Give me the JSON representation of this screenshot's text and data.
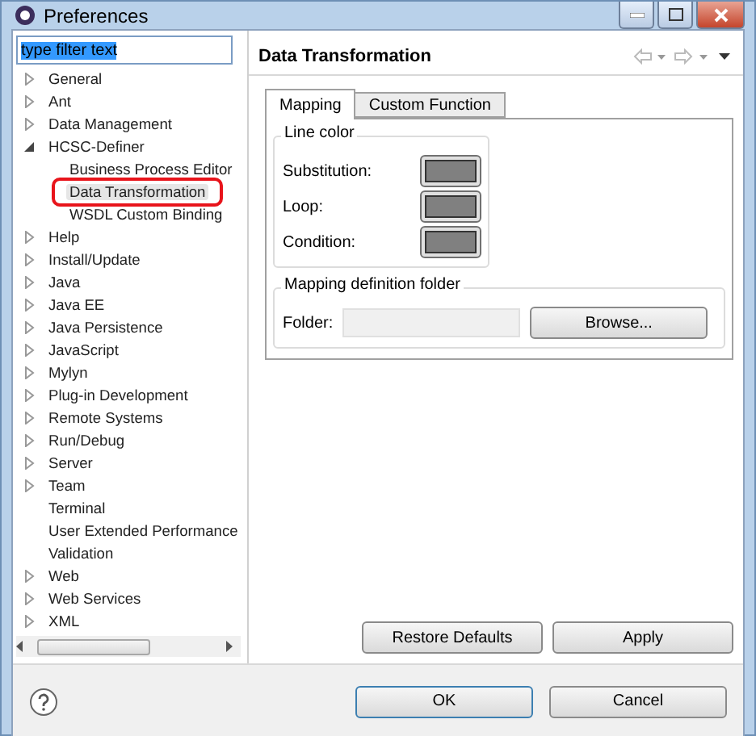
{
  "window": {
    "title": "Preferences"
  },
  "filter": {
    "value": "type filter text"
  },
  "tree": [
    {
      "label": "General",
      "expanded": false,
      "selected": false,
      "highlighted": false
    },
    {
      "label": "Ant",
      "expanded": false,
      "selected": false,
      "highlighted": false
    },
    {
      "label": "Data Management",
      "expanded": false,
      "selected": false,
      "highlighted": false
    },
    {
      "label": "HCSC-Definer",
      "expanded": true,
      "selected": false,
      "highlighted": false,
      "children": [
        {
          "label": "Business Process Editor",
          "selected": false,
          "highlighted": false
        },
        {
          "label": "Data Transformation",
          "selected": true,
          "highlighted": true
        },
        {
          "label": "WSDL Custom Binding",
          "selected": false,
          "highlighted": false
        }
      ]
    },
    {
      "label": "Help",
      "expanded": false,
      "selected": false,
      "highlighted": false
    },
    {
      "label": "Install/Update",
      "expanded": false,
      "selected": false,
      "highlighted": false
    },
    {
      "label": "Java",
      "expanded": false,
      "selected": false,
      "highlighted": false
    },
    {
      "label": "Java EE",
      "expanded": false,
      "selected": false,
      "highlighted": false
    },
    {
      "label": "Java Persistence",
      "expanded": false,
      "selected": false,
      "highlighted": false
    },
    {
      "label": "JavaScript",
      "expanded": false,
      "selected": false,
      "highlighted": false
    },
    {
      "label": "Mylyn",
      "expanded": false,
      "selected": false,
      "highlighted": false
    },
    {
      "label": "Plug-in Development",
      "expanded": false,
      "selected": false,
      "highlighted": false
    },
    {
      "label": "Remote Systems",
      "expanded": false,
      "selected": false,
      "highlighted": false
    },
    {
      "label": "Run/Debug",
      "expanded": false,
      "selected": false,
      "highlighted": false
    },
    {
      "label": "Server",
      "expanded": false,
      "selected": false,
      "highlighted": false
    },
    {
      "label": "Team",
      "expanded": false,
      "selected": false,
      "highlighted": false
    },
    {
      "label": "Terminal",
      "selected": false,
      "highlighted": false
    },
    {
      "label": "User Extended Performance",
      "selected": false,
      "highlighted": false
    },
    {
      "label": "Validation",
      "selected": false,
      "highlighted": false
    },
    {
      "label": "Web",
      "expanded": false,
      "selected": false,
      "highlighted": false
    },
    {
      "label": "Web Services",
      "expanded": false,
      "selected": false,
      "highlighted": false
    },
    {
      "label": "XML",
      "expanded": false,
      "selected": false,
      "highlighted": false
    }
  ],
  "page": {
    "title": "Data Transformation",
    "tabs": [
      {
        "label": "Mapping",
        "selected": true
      },
      {
        "label": "Custom Function",
        "selected": false
      }
    ],
    "line_color": {
      "title": "Line color",
      "rows": [
        {
          "label": "Substitution:",
          "color": "#808080"
        },
        {
          "label": "Loop:",
          "color": "#808080"
        },
        {
          "label": "Condition:",
          "color": "#808080"
        }
      ]
    },
    "folder": {
      "title": "Mapping definition folder",
      "label": "Folder:",
      "button": "Browse..."
    },
    "buttons": [
      "Restore Defaults",
      "Apply"
    ]
  },
  "dialog_buttons": [
    {
      "label": "OK",
      "default": true
    },
    {
      "label": "Cancel",
      "default": false
    }
  ]
}
